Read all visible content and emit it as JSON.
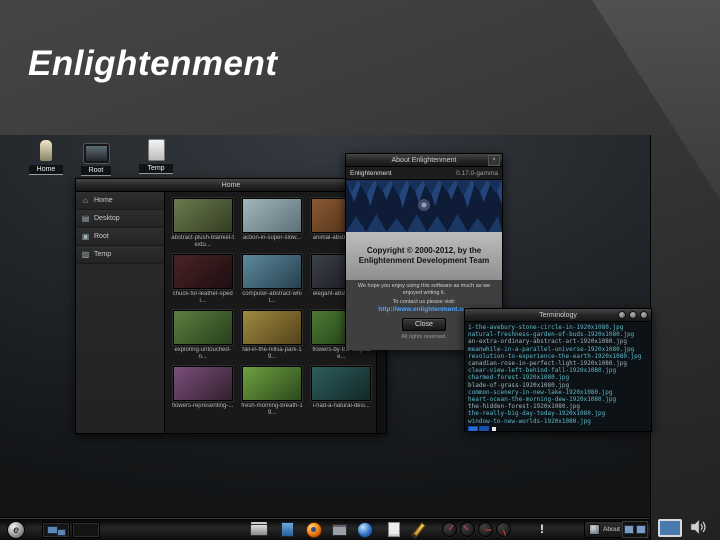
{
  "slide": {
    "title": "Enlightenment"
  },
  "colors": {
    "url_blue": "#4aa3ff",
    "logo_navy": "#0e1c38",
    "desktop_dark": "#23272b"
  },
  "desktop": {
    "icons": [
      {
        "label": "Home"
      },
      {
        "label": "Root"
      },
      {
        "label": "Temp"
      }
    ],
    "filemanager": {
      "title": "Home",
      "sidebar": [
        {
          "icon": "⌂",
          "label": "Home"
        },
        {
          "icon": "▤",
          "label": "Desktop"
        },
        {
          "icon": "▣",
          "label": "Root"
        },
        {
          "icon": "▨",
          "label": "Temp"
        }
      ],
      "files": [
        {
          "caption": "abstract-plush-blanket-textu...",
          "bg": "linear-gradient(140deg,#6b7a4e,#333d22)"
        },
        {
          "caption": "action-in-super-slow...",
          "bg": "linear-gradient(140deg,#a3b6be,#5d7077)"
        },
        {
          "caption": "animal-abstract-gall...",
          "bg": "linear-gradient(140deg,#8a5a33,#4a2c14)"
        },
        {
          "caption": "chuck-for-leather-spedi...",
          "bg": "linear-gradient(140deg,#4a2326,#1d0e10)"
        },
        {
          "caption": "computer-abstract-whit...",
          "bg": "linear-gradient(140deg,#5d8a9e,#27404d)"
        },
        {
          "caption": "elegant-abstract-art...",
          "bg": "linear-gradient(140deg,#3c4047,#16181c)"
        },
        {
          "caption": "exploring-untouched-n...",
          "bg": "linear-gradient(140deg,#5d7e3f,#26401c)"
        },
        {
          "caption": "fall-in-the-hillsa-park-19...",
          "bg": "linear-gradient(140deg,#9e8a3f,#55431c)"
        },
        {
          "caption": "flowers-by-the-wayside...",
          "bg": "linear-gradient(140deg,#4e7a33,#1c3a14)"
        },
        {
          "caption": "flowers-representing-...",
          "bg": "linear-gradient(140deg,#7a4e7a,#33202e)"
        },
        {
          "caption": "fresh-morning-breath-19...",
          "bg": "linear-gradient(140deg,#6fa040,#2c4a1c)"
        },
        {
          "caption": "i-had-a-natural-desi...",
          "bg": "linear-gradient(140deg,#2e5d5d,#122828)"
        }
      ]
    },
    "about": {
      "title": "About Enlightenment",
      "close_glyph": "×",
      "app_name": "Enlightenment",
      "version": "0.17.0-gamma",
      "copyright": "Copyright © 2000-2012, by the Enlightenment Development Team",
      "message": "We hope you enjoy using this software as much as we enjoyed writing it.",
      "contact": "To contact us please visit:",
      "url": "http://www.enlightenment.org",
      "close_label": "Close",
      "rights": "All rights reserved."
    },
    "terminal": {
      "title": "Terminology",
      "lines": [
        "1-the-avebury-stone-circle-in-1920x1080.jpg",
        "natural-freshness-garden-of-buds-1920x1080.jpg",
        "an-extra-ordinary-abstract-art-1920x1080.jpg",
        "meanwhile-in-a-parallel-universe-1920x1080.jpg",
        "revolution-to-experience-the-earth-1920x1080.jpg",
        "canadian-rose-in-perfect-light-1920x1080.jpg",
        "clear-view-left-behind-fall-1920x1080.jpg",
        "charmed-forest-1920x1080.jpg",
        "blade-of-grass-1920x1080.jpg",
        "common-scenery-in-new-lake-1920x1080.jpg",
        "heart-ocean-the-morning-dew-1920x1080.jpg",
        "the-hidden-forest-1920x1080.jpg",
        "the-really-big-day-today-1920x1080.jpg",
        "window-to-new-worlds-1920x1080.jpg"
      ]
    },
    "shelf": {
      "start_glyph": "e",
      "warning_glyph": "!",
      "about_task_label": "About Enl...",
      "icons": [
        "start-button",
        "pager-desktop-1",
        "pager-desktop-2",
        "printer-icon",
        "document-icon",
        "firefox-icon",
        "window-icon",
        "globe-icon",
        "file-icon",
        "pencil-icon",
        "gauge-icon",
        "gauge-icon",
        "gauge-icon",
        "gauge-icon",
        "warning-icon",
        "task-about",
        "icon-tray"
      ]
    }
  }
}
